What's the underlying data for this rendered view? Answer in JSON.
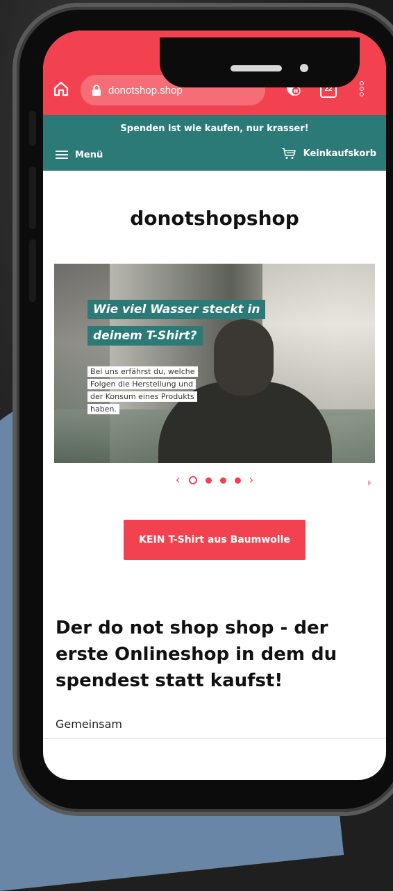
{
  "browser": {
    "url": "donotshop.shop",
    "tabs_count": "22"
  },
  "header": {
    "promo_text": "Spenden ist wie kaufen, nur krasser!",
    "menu_label": "Menü",
    "cart_label": "Keinkaufskorb"
  },
  "main": {
    "shop_title": "donotshopshop",
    "hero": {
      "headline_line1": "Wie viel Wasser steckt in",
      "headline_line2": "deinem T-Shirt?",
      "body_lines": [
        "Bei uns erfährst du, welche",
        "Folgen die Herstellung und",
        "der Konsum eines Produkts",
        "haben."
      ]
    },
    "slider": {
      "slides": 4,
      "active_index": 0
    },
    "cta_label": "KEIN T-Shirt aus Baumwolle",
    "heading": "Der do not shop shop - der erste Onlineshop in dem du spendest statt kaufst!",
    "paragraph_start": "Gemeinsam"
  },
  "colors": {
    "accent": "#f2424f",
    "teal": "#2b7a78"
  },
  "icons": [
    "home-icon",
    "lock-icon",
    "adblock-icon",
    "tabs-icon",
    "kebab-menu-icon",
    "hamburger-icon",
    "cart-icon",
    "chevron-left-icon",
    "chevron-right-icon"
  ]
}
